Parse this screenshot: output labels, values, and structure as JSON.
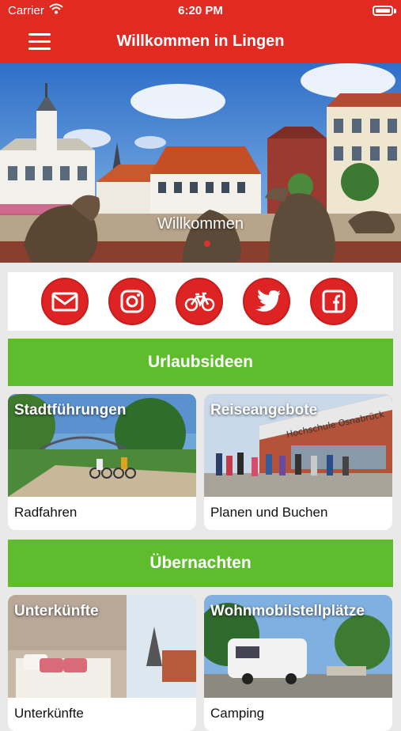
{
  "status": {
    "carrier": "Carrier",
    "time": "6:20 PM"
  },
  "navbar": {
    "title": "Willkommen in Lingen",
    "menu_icon": "hamburger-menu-icon"
  },
  "hero": {
    "caption": "Willkommen"
  },
  "social": [
    {
      "name": "email",
      "icon": "mail-icon"
    },
    {
      "name": "instagram",
      "icon": "instagram-icon"
    },
    {
      "name": "bike",
      "icon": "bicycle-icon"
    },
    {
      "name": "twitter",
      "icon": "twitter-icon"
    },
    {
      "name": "facebook",
      "icon": "facebook-icon"
    }
  ],
  "sections": {
    "urlaubsideen": "Urlaubsideen",
    "uebernachten": "Übernachten"
  },
  "cards": {
    "c1": {
      "overlay": "Stadtführungen",
      "label": "Radfahren"
    },
    "c2": {
      "overlay": "Reiseangebote",
      "label": "Planen und Buchen",
      "sign": "Hochschule Osnabrück"
    },
    "c3": {
      "overlay": "Unterkünfte",
      "label": "Unterkünfte"
    },
    "c4": {
      "overlay": "Wohnmobilstellplätze",
      "label": "Camping"
    }
  },
  "colors": {
    "brand_red": "#e02a22",
    "accent_green": "#5fbd2d",
    "icon_red": "#dd2323"
  }
}
